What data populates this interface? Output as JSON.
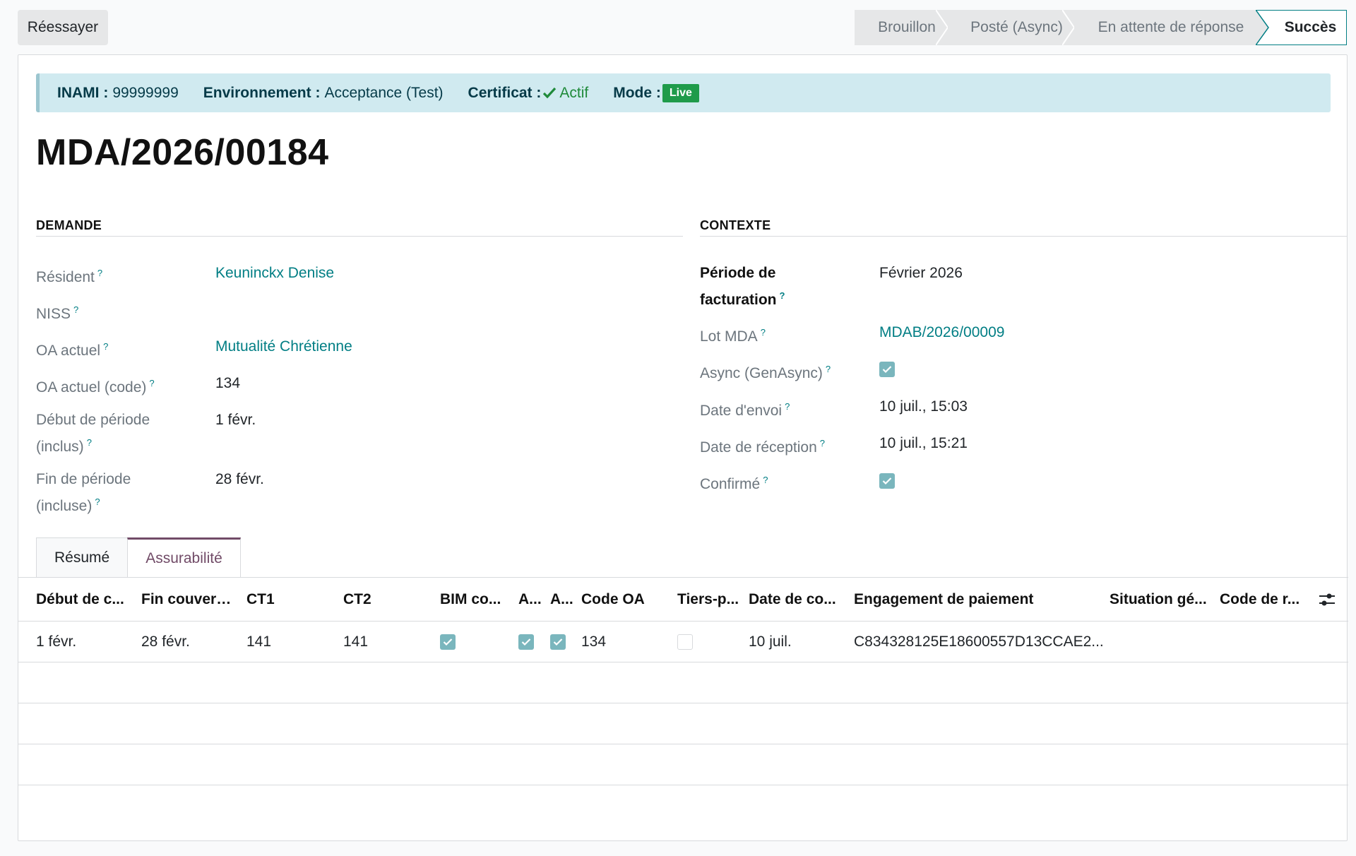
{
  "toolbar": {
    "retry_label": "Réessayer"
  },
  "statusbar": {
    "steps": [
      "Brouillon",
      "Posté (Async)",
      "En attente de réponse",
      "Succès"
    ],
    "current": "Succès"
  },
  "banner": {
    "inami_label": "INAMI :",
    "inami_value": "99999999",
    "env_label": "Environnement :",
    "env_value": "Acceptance (Test)",
    "cert_label": "Certificat :",
    "cert_value": "Actif",
    "mode_label": "Mode :",
    "mode_value": "Live",
    "bg_color": "#d0eaf0",
    "ok_color": "#1f8a3a",
    "live_color": "#1f9b4a"
  },
  "record": {
    "title": "MDA/2026/00184"
  },
  "demande": {
    "title": "DEMANDE",
    "fields": [
      {
        "label": "Résident",
        "value": "Keuninckx Denise"
      },
      {
        "label": "NISS",
        "value": ""
      },
      {
        "label": "OA actuel",
        "value": "Mutualité Chrétienne"
      },
      {
        "label": "OA actuel (code)",
        "value": "134"
      },
      {
        "label": "Début de période (inclus)",
        "value": "1 févr."
      },
      {
        "label": "Fin de période (incluse)",
        "value": "28 févr."
      }
    ]
  },
  "contexte": {
    "title": "CONTEXTE",
    "fields": [
      {
        "label": "Période de facturation",
        "value": "Février 2026"
      },
      {
        "label": "Lot MDA",
        "value": "MDAB/2026/00009"
      },
      {
        "label": "Async (GenAsync)",
        "checked": true
      },
      {
        "label": "Date d'envoi",
        "value": "10 juil., 15:03"
      },
      {
        "label": "Date de réception",
        "value": "10 juil., 15:21"
      },
      {
        "label": "Confirmé",
        "checked": true
      }
    ]
  },
  "tabs": [
    {
      "label": "Résumé",
      "active": false
    },
    {
      "label": "Assurabilité",
      "active": true
    }
  ],
  "table": {
    "columns": [
      "Début de c...",
      "Fin couvert...",
      "CT1",
      "CT2",
      "BIM co...",
      "A...",
      "A...",
      "Code OA",
      "Tiers-p...",
      "Date de co...",
      "Engagement de paiement",
      "Situation gé...",
      "Code de r..."
    ],
    "rows": [
      {
        "debut": "1 févr.",
        "fin": "28 févr.",
        "ct1": "141",
        "ct2": "141",
        "bim": true,
        "a1": true,
        "a2": true,
        "code_oa": "134",
        "tiers": false,
        "date_co": "10 juil.",
        "engagement": "C834328125E18600557D13CCAE2...",
        "situation": "",
        "code_r": ""
      }
    ]
  },
  "colors": {
    "accent": "#017e84",
    "tab_active": "#714b67",
    "checkbox": "#7ab6bd"
  },
  "icons": [
    "check-icon",
    "help-icon",
    "column-options-icon",
    "chevron-separator-icon"
  ]
}
